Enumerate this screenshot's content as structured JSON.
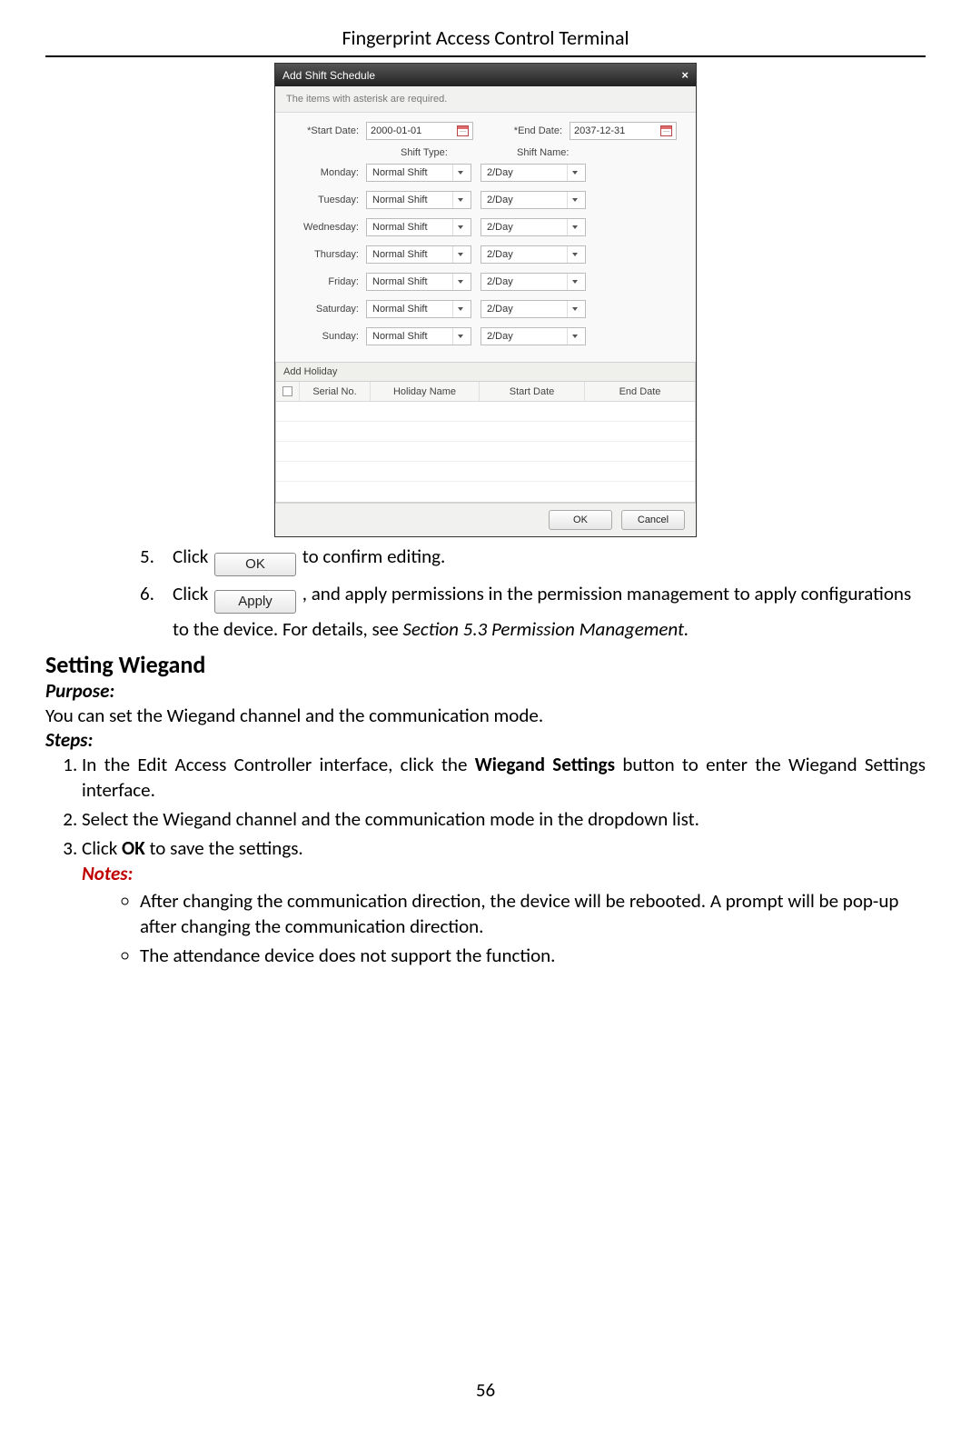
{
  "page": {
    "header": "Fingerprint Access Control Terminal",
    "number": "56"
  },
  "dialog": {
    "title": "Add Shift Schedule",
    "notice": "The items with asterisk are required.",
    "start_date_label": "*Start Date:",
    "start_date_value": "2000-01-01",
    "end_date_label": "*End Date:",
    "end_date_value": "2037-12-31",
    "shift_type_header": "Shift Type:",
    "shift_name_header": "Shift Name:",
    "days": [
      {
        "label": "Monday:",
        "type": "Normal Shift",
        "name": "2/Day"
      },
      {
        "label": "Tuesday:",
        "type": "Normal Shift",
        "name": "2/Day"
      },
      {
        "label": "Wednesday:",
        "type": "Normal Shift",
        "name": "2/Day"
      },
      {
        "label": "Thursday:",
        "type": "Normal Shift",
        "name": "2/Day"
      },
      {
        "label": "Friday:",
        "type": "Normal Shift",
        "name": "2/Day"
      },
      {
        "label": "Saturday:",
        "type": "Normal Shift",
        "name": "2/Day"
      },
      {
        "label": "Sunday:",
        "type": "Normal Shift",
        "name": "2/Day"
      }
    ],
    "holiday_section": "Add Holiday",
    "holiday_cols": {
      "serial": "Serial No.",
      "name": "Holiday Name",
      "start": "Start Date",
      "end": "End Date"
    },
    "ok": "OK",
    "cancel": "Cancel"
  },
  "buttons": {
    "ok": "OK",
    "apply": "Apply"
  },
  "doc": {
    "step5_num": "5.",
    "step5_a": "Click ",
    "step5_b": " to confirm editing.",
    "step6_num": "6.",
    "step6_a": "Click ",
    "step6_b": ", and apply permissions in the permission management to apply configurations to the device. For details, see ",
    "step6_ref": "Section 5.3 Permission Management.",
    "section_title": "Setting Wiegand",
    "purpose_label": "Purpose:",
    "purpose_text": "You can set the Wiegand channel and the communication mode.",
    "steps_label": "Steps:",
    "ol1_a": "In the Edit Access Controller interface, click the ",
    "ol1_b": "Wiegand Settings",
    "ol1_c": " button to enter the Wiegand Settings interface.",
    "ol2": "Select the Wiegand channel and the communication mode in the dropdown list.",
    "ol3_a": "Click ",
    "ol3_b": "OK",
    "ol3_c": " to save the settings.",
    "notes_label": "Notes:",
    "note1": "After changing the communication direction, the device will be rebooted. A prompt will be pop-up after changing the communication direction.",
    "note2": "The attendance device does not support the function."
  }
}
